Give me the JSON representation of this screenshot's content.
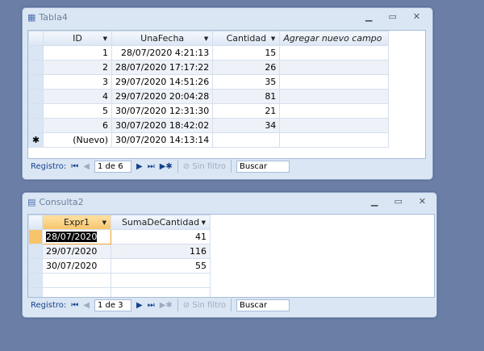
{
  "tabla4": {
    "title": "Tabla4",
    "columns": [
      "ID",
      "UnaFecha",
      "Cantidad",
      "Agregar nuevo campo"
    ],
    "rows": [
      [
        "1",
        "28/07/2020 4:21:13",
        "15"
      ],
      [
        "2",
        "28/07/2020 17:17:22",
        "26"
      ],
      [
        "3",
        "29/07/2020 14:51:26",
        "35"
      ],
      [
        "4",
        "29/07/2020 20:04:28",
        "81"
      ],
      [
        "5",
        "30/07/2020 12:31:30",
        "21"
      ],
      [
        "6",
        "30/07/2020 18:42:02",
        "34"
      ]
    ],
    "new_row": {
      "marker": "✱",
      "id": "(Nuevo)",
      "fecha": "30/07/2020 14:13:14"
    },
    "nav": {
      "label": "Registro:",
      "position": "1 de 6",
      "filter": "Sin filtro",
      "search": "Buscar"
    }
  },
  "consulta2": {
    "title": "Consulta2",
    "columns": [
      "Expr1",
      "SumaDeCantidad"
    ],
    "rows": [
      [
        "28/07/2020",
        "41"
      ],
      [
        "29/07/2020",
        "116"
      ],
      [
        "30/07/2020",
        "55"
      ]
    ],
    "nav": {
      "label": "Registro:",
      "position": "1 de 3",
      "filter": "Sin filtro",
      "search": "Buscar"
    }
  },
  "window_controls": {
    "minimize": "▁",
    "maximize": "▭",
    "close": "✕"
  }
}
